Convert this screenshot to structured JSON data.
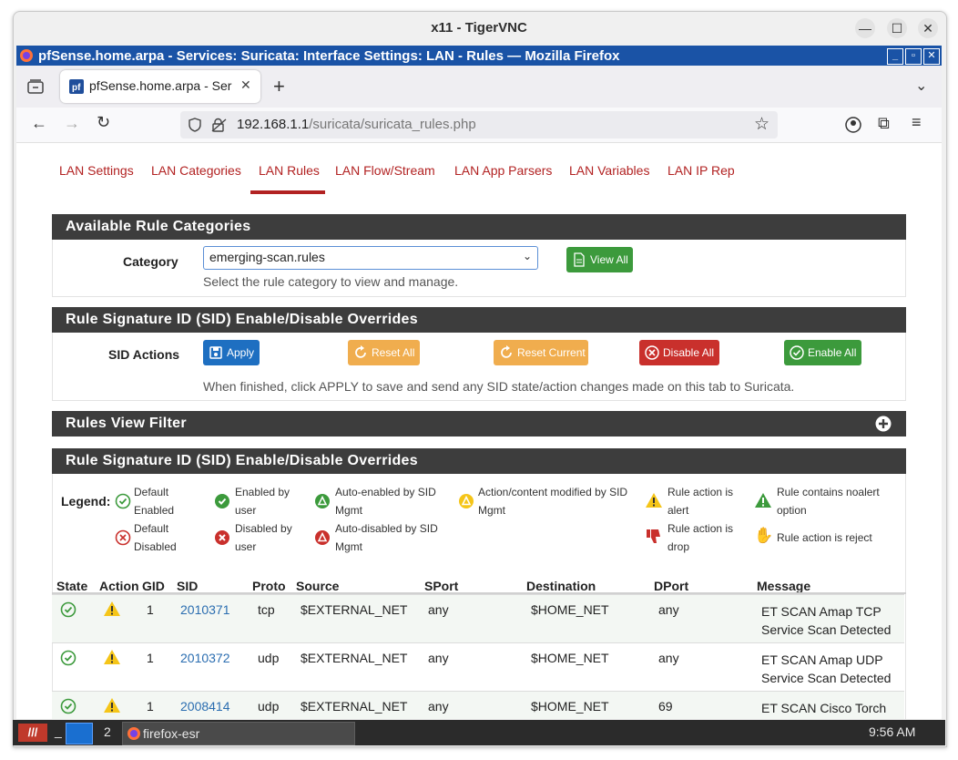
{
  "vnc": {
    "title": "x11 - TigerVNC",
    "min": "—",
    "max": "☐",
    "close": "✕"
  },
  "browser": {
    "window_title": "pfSense.home.arpa - Services: Suricata: Interface Settings: LAN - Rules — Mozilla Firefox",
    "tab_title": "pfSense.home.arpa - Ser",
    "new_tab": "+",
    "url_host": "192.168.1.1",
    "url_path": "/suricata/suricata_rules.php"
  },
  "nav_tabs": [
    {
      "label": "LAN Settings"
    },
    {
      "label": "LAN Categories"
    },
    {
      "label": "LAN Rules",
      "active": true
    },
    {
      "label": "LAN Flow/Stream"
    },
    {
      "label": "LAN App Parsers"
    },
    {
      "label": "LAN Variables"
    },
    {
      "label": "LAN IP Rep"
    }
  ],
  "categories_panel": {
    "title": "Available Rule Categories",
    "label": "Category",
    "selected": "emerging-scan.rules",
    "help": "Select the rule category to view and manage.",
    "view_all": "View All"
  },
  "sid_panel": {
    "title": "Rule Signature ID (SID) Enable/Disable Overrides",
    "label": "SID Actions",
    "apply": "Apply",
    "reset_all": "Reset All",
    "reset_current": "Reset Current",
    "disable_all": "Disable All",
    "enable_all": "Enable All",
    "help": "When finished, click APPLY to save and send any SID state/action changes made on this tab to Suricata."
  },
  "filter_panel": {
    "title": "Rules View Filter"
  },
  "rules_panel": {
    "title": "Rule Signature ID (SID) Enable/Disable Overrides",
    "legend_label": "Legend:",
    "legend": {
      "default_enabled": [
        "Default",
        "Enabled"
      ],
      "enabled_by_user": [
        "Enabled by",
        "user"
      ],
      "auto_enabled": [
        "Auto-enabled by SID",
        "Mgmt"
      ],
      "action_modified": [
        "Action/content modified by SID",
        "Mgmt"
      ],
      "action_alert": [
        "Rule action is",
        "alert"
      ],
      "noalert": [
        "Rule contains noalert",
        "option"
      ],
      "default_disabled": [
        "Default",
        "Disabled"
      ],
      "disabled_by_user": [
        "Disabled by",
        "user"
      ],
      "auto_disabled": [
        "Auto-disabled by SID",
        "Mgmt"
      ],
      "action_drop": [
        "Rule action is",
        "drop"
      ],
      "action_reject": [
        "Rule action is reject"
      ]
    },
    "columns": [
      "State",
      "Action",
      "GID",
      "SID",
      "Proto",
      "Source",
      "SPort",
      "Destination",
      "DPort",
      "Message"
    ],
    "rows": [
      {
        "gid": "1",
        "sid": "2010371",
        "proto": "tcp",
        "source": "$EXTERNAL_NET",
        "sport": "any",
        "destination": "$HOME_NET",
        "dport": "any",
        "message": "ET SCAN Amap TCP Service Scan Detected"
      },
      {
        "gid": "1",
        "sid": "2010372",
        "proto": "udp",
        "source": "$EXTERNAL_NET",
        "sport": "any",
        "destination": "$HOME_NET",
        "dport": "any",
        "message": "ET SCAN Amap UDP Service Scan Detected"
      },
      {
        "gid": "1",
        "sid": "2008414",
        "proto": "udp",
        "source": "$EXTERNAL_NET",
        "sport": "any",
        "destination": "$HOME_NET",
        "dport": "69",
        "message": "ET SCAN Cisco Torch"
      }
    ]
  },
  "taskbar": {
    "workspace": "2",
    "app": "firefox-esr",
    "clock": "9:56 AM"
  },
  "colors": {
    "accent_red": "#b22222",
    "success": "#3c9a3c",
    "warning": "#f0ad4e",
    "danger": "#c9302c",
    "primary": "#1e6fc1"
  }
}
